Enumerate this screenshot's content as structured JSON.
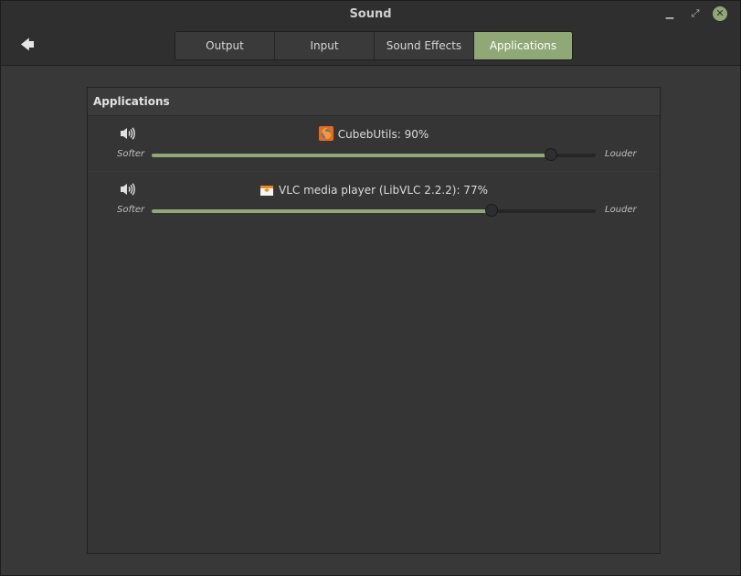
{
  "window": {
    "title": "Sound"
  },
  "icons": {
    "back": "back-arrow-icon",
    "minimize": "minimize-icon",
    "maximize": "maximize-icon",
    "close": "close-icon",
    "speaker": "speaker-icon"
  },
  "tabs": [
    {
      "label": "Output",
      "active": false
    },
    {
      "label": "Input",
      "active": false
    },
    {
      "label": "Sound Effects",
      "active": false
    },
    {
      "label": "Applications",
      "active": true
    }
  ],
  "applications": {
    "heading": "Applications",
    "softer_label": "Softer",
    "louder_label": "Louder",
    "items": [
      {
        "label": "CubebUtils: 90%",
        "icon": "firefox-icon",
        "volume": 0.9
      },
      {
        "label": "VLC media player (LibVLC 2.2.2): 77%",
        "icon": "vlc-icon",
        "volume": 0.766
      }
    ]
  },
  "colors": {
    "accent": "#8fa876"
  }
}
